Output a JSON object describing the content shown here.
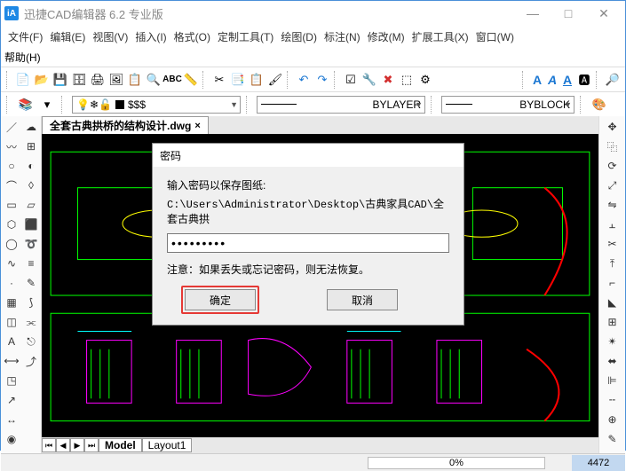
{
  "titlebar": {
    "app_icon_text": "iA",
    "title": "迅捷CAD编辑器 6.2 专业版"
  },
  "menu": {
    "file": "文件(F)",
    "edit": "编辑(E)",
    "view": "视图(V)",
    "insert": "插入(I)",
    "format": "格式(O)",
    "custom_tools": "定制工具(T)",
    "draw": "绘图(D)",
    "annotate": "标注(N)",
    "modify": "修改(M)",
    "ext_tools": "扩展工具(X)",
    "window": "窗口(W)",
    "help": "帮助(H)"
  },
  "props": {
    "dollar": "$$$",
    "layer": "BYLAYER",
    "block": "BYBLOCK"
  },
  "doc": {
    "tab_title": "全套古典拱桥的结构设计.dwg"
  },
  "layout": {
    "model": "Model",
    "layout1": "Layout1"
  },
  "status": {
    "percent": "0%",
    "coord": "4472"
  },
  "dialog": {
    "title": "密码",
    "prompt": "输入密码以保存图纸:",
    "path": "C:\\Users\\Administrator\\Desktop\\古典家具CAD\\全套古典拱",
    "password_value": "●●●●●●●●●",
    "warning": "注意：如果丢失或忘记密码，则无法恢复。",
    "ok": "确定",
    "cancel": "取消"
  }
}
